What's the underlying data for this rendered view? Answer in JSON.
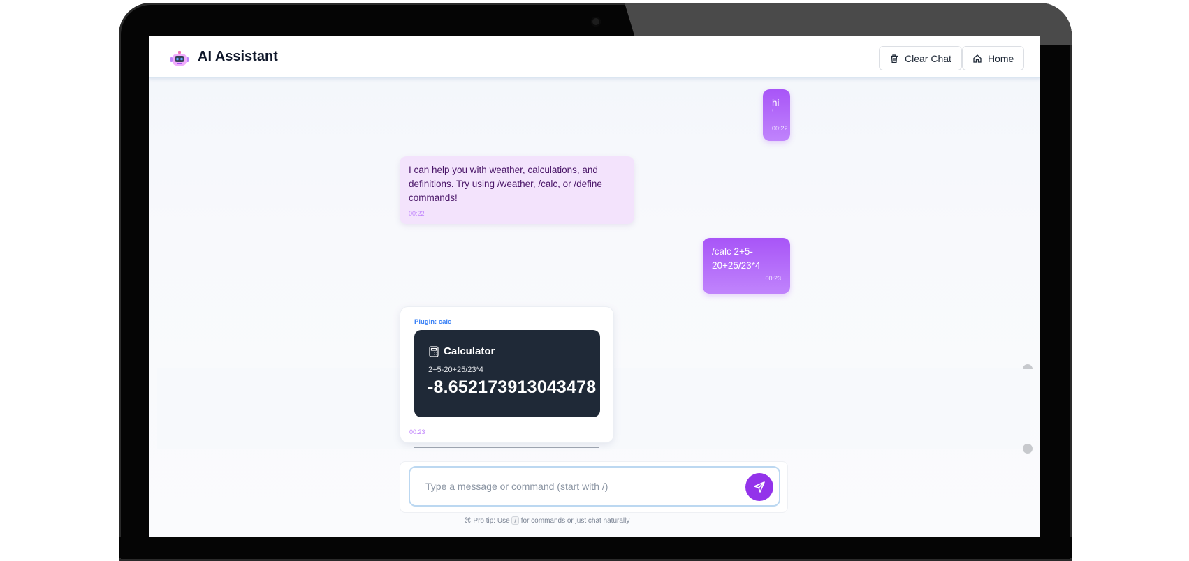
{
  "header": {
    "title": "AI Assistant",
    "clear_label": "Clear Chat",
    "home_label": "Home"
  },
  "messages": [
    {
      "role": "user",
      "text_lines": [
        "hi",
        "'"
      ],
      "time": "00:22"
    },
    {
      "role": "bot",
      "text": "I can help you with weather, calculations, and definitions. Try using /weather, /calc, or /define commands!",
      "time": "00:22"
    },
    {
      "role": "user",
      "text_lines": [
        "/calc 2+5-",
        "20+25/23*4"
      ],
      "time": "00:23"
    }
  ],
  "plugin": {
    "label": "Plugin: calc",
    "title": "Calculator",
    "expression": "2+5-20+25/23*4",
    "result": "-8.652173913043478",
    "time": "00:23"
  },
  "composer": {
    "placeholder": "Type a message or command (start with /)"
  },
  "tip": {
    "prefix": "⌘ Pro tip: Use",
    "key": "/",
    "suffix": "for commands or just chat naturally"
  },
  "colors": {
    "accent": "#9333ea",
    "user_bubble": "#a855f7",
    "bot_bubble": "#f3e3fc",
    "calc_bg": "#1f2937",
    "plugin_label": "#3b82f6"
  }
}
